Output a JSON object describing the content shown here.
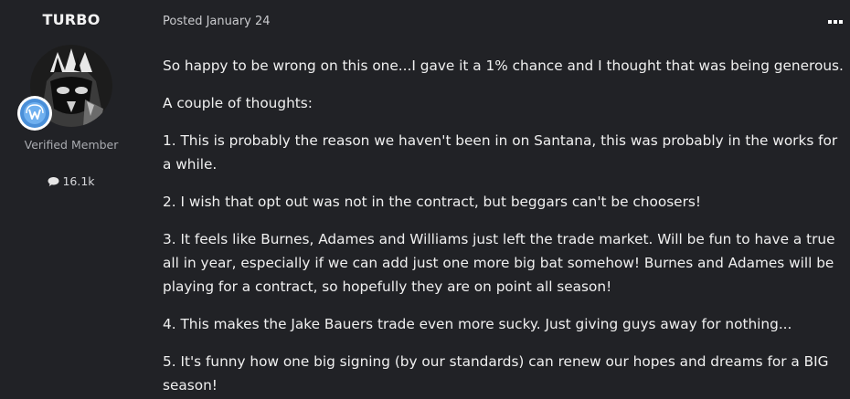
{
  "author": {
    "username": "TURBO",
    "avatar_icon": "avatar-image",
    "badge_icon": "verified-badge-icon",
    "title": "Verified Member",
    "post_count": "16.1k",
    "post_count_icon": "comment-bubble-icon"
  },
  "post": {
    "posted_label": "Posted January 24",
    "menu_icon": "more-options-icon",
    "paragraphs": [
      "So happy to be wrong on this one...I gave it a 1% chance and I thought that was being generous.",
      "A couple of thoughts:",
      "1. This is probably the reason we haven't been in on Santana, this was probably in the works for a while.",
      "2. I wish that opt out was not in the contract, but beggars can't be choosers!",
      "3. It feels like Burnes, Adames and Williams just left the trade market.  Will be fun to have a true all in year, especially if we can add just one more big bat somehow!  Burnes and Adames will be playing for a contract, so hopefully they are on point all season!",
      "4. This makes the Jake Bauers trade even more sucky.  Just giving guys away for nothing...",
      "5. It's funny how one big signing (by our standards) can renew our hopes and dreams for a BIG season!"
    ]
  },
  "colors": {
    "background": "#212226",
    "text": "#f0f0f0",
    "muted": "#a9abb0",
    "badge_blue": "#4a8fd8"
  }
}
